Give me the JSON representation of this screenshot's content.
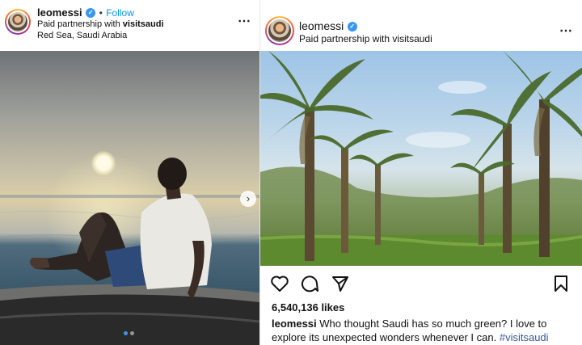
{
  "left_post": {
    "username": "leomessi",
    "verified_mark": "✓",
    "follow_label": "Follow",
    "separator": "•",
    "partnership_prefix": "Paid partnership with",
    "partner": "visitsaudi",
    "location": "Red Sea, Saudi Arabia",
    "more_icon": "⋯",
    "next_icon": "›",
    "carousel": {
      "count": 2,
      "active": 1
    }
  },
  "right_post": {
    "username": "leomessi",
    "verified_mark": "✓",
    "partnership_prefix": "Paid partnership with",
    "partner": "visitsaudi",
    "more_icon": "⋯",
    "likes": "6,540,136 likes",
    "caption_user": "leomessi",
    "caption_text": " Who thought Saudi has so much green? I love to explore its unexpected wonders whenever I can. ",
    "caption_hashtag": "#visitsaudi"
  },
  "colors": {
    "link": "#0095f6",
    "verified": "#3897f0",
    "hashtag": "#385898"
  },
  "icons": [
    "verified-icon",
    "more-options-icon",
    "next-arrow-icon",
    "heart-icon",
    "comment-icon",
    "share-icon",
    "bookmark-icon"
  ]
}
